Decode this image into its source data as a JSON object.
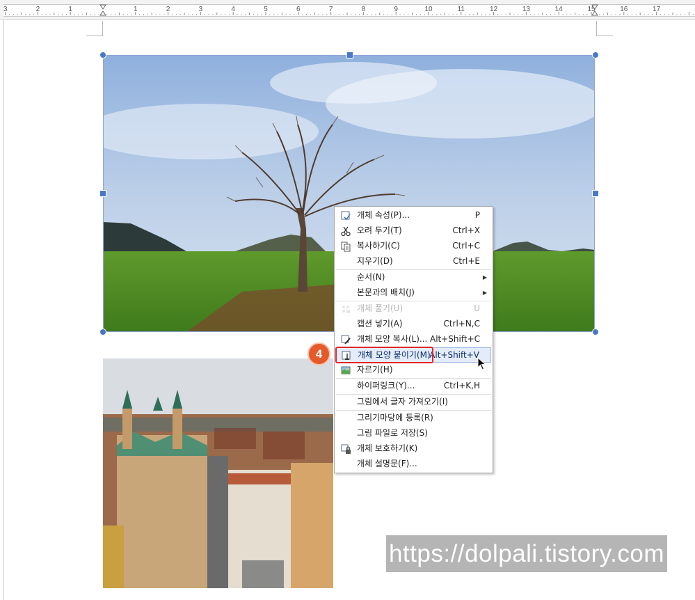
{
  "ruler": {
    "labels": [
      "3",
      "2",
      "1",
      "1",
      "2",
      "3",
      "4",
      "5",
      "6",
      "7",
      "8",
      "9",
      "10",
      "11",
      "12",
      "13",
      "14",
      "15",
      "16",
      "17"
    ]
  },
  "context_menu": {
    "items": [
      {
        "type": "item",
        "icon": "object-properties-icon",
        "label": "개체 속성(P)...",
        "shortcut": "P",
        "disabled": false
      },
      {
        "type": "item",
        "icon": "scissors-icon",
        "label": "오려 두기(T)",
        "shortcut": "Ctrl+X",
        "disabled": false
      },
      {
        "type": "item",
        "icon": "copy-icon",
        "label": "복사하기(C)",
        "shortcut": "Ctrl+C",
        "disabled": false
      },
      {
        "type": "item",
        "icon": "",
        "label": "지우기(D)",
        "shortcut": "Ctrl+E",
        "disabled": false
      },
      {
        "type": "separator"
      },
      {
        "type": "submenu",
        "icon": "",
        "label": "순서(N)",
        "shortcut": "",
        "disabled": false
      },
      {
        "type": "submenu",
        "icon": "",
        "label": "본문과의 배치(J)",
        "shortcut": "",
        "disabled": false
      },
      {
        "type": "separator"
      },
      {
        "type": "item",
        "icon": "ungroup-icon",
        "label": "개체 풀기(U)",
        "shortcut": "U",
        "disabled": true
      },
      {
        "type": "item",
        "icon": "",
        "label": "캡션 넣기(A)",
        "shortcut": "Ctrl+N,C",
        "disabled": false
      },
      {
        "type": "item",
        "icon": "copy-format-icon",
        "label": "개체 모양 복사(L)...",
        "shortcut": "Alt+Shift+C",
        "disabled": false
      },
      {
        "type": "item",
        "icon": "paste-format-icon",
        "label": "개체 모양 붙이기(M)",
        "shortcut": "Alt+Shift+V",
        "disabled": false,
        "highlighted": true
      },
      {
        "type": "item",
        "icon": "crop-icon",
        "label": "자르기(H)",
        "shortcut": "",
        "disabled": false
      },
      {
        "type": "separator"
      },
      {
        "type": "item",
        "icon": "",
        "label": "하이퍼링크(Y)...",
        "shortcut": "Ctrl+K,H",
        "disabled": false
      },
      {
        "type": "separator"
      },
      {
        "type": "item",
        "icon": "",
        "label": "그림에서 글자 가져오기(I)",
        "shortcut": "",
        "disabled": false
      },
      {
        "type": "separator"
      },
      {
        "type": "item",
        "icon": "",
        "label": "그리기마당에 등록(R)",
        "shortcut": "",
        "disabled": false
      },
      {
        "type": "item",
        "icon": "",
        "label": "그림 파일로 저장(S)",
        "shortcut": "",
        "disabled": false
      },
      {
        "type": "item",
        "icon": "lock-icon",
        "label": "개체 보호하기(K)",
        "shortcut": "",
        "disabled": false
      },
      {
        "type": "item",
        "icon": "",
        "label": "개체 설명문(F)...",
        "shortcut": "",
        "disabled": false
      }
    ]
  },
  "step_badge": "4",
  "watermark": "https://dolpali.tistory.com",
  "colors": {
    "selection_handle": "#4a78c9",
    "highlight_box": "#e0262c",
    "badge": "#e55a2a"
  }
}
